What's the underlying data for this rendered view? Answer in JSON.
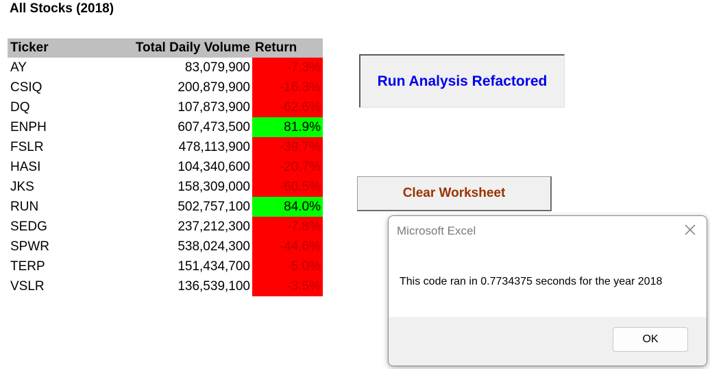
{
  "sheet": {
    "title": "All Stocks (2018)"
  },
  "table": {
    "headers": {
      "ticker": "Ticker",
      "volume": "Total Daily Volume",
      "return": "Return"
    },
    "rows": [
      {
        "ticker": "AY",
        "volume": "83,079,900",
        "return": "-7.3%",
        "status": "negative"
      },
      {
        "ticker": "CSIQ",
        "volume": "200,879,900",
        "return": "-16.3%",
        "status": "negative"
      },
      {
        "ticker": "DQ",
        "volume": "107,873,900",
        "return": "-62.6%",
        "status": "negative"
      },
      {
        "ticker": "ENPH",
        "volume": "607,473,500",
        "return": "81.9%",
        "status": "positive"
      },
      {
        "ticker": "FSLR",
        "volume": "478,113,900",
        "return": "-39.7%",
        "status": "negative"
      },
      {
        "ticker": "HASI",
        "volume": "104,340,600",
        "return": "-20.7%",
        "status": "negative"
      },
      {
        "ticker": "JKS",
        "volume": "158,309,000",
        "return": "-60.5%",
        "status": "negative"
      },
      {
        "ticker": "RUN",
        "volume": "502,757,100",
        "return": "84.0%",
        "status": "positive"
      },
      {
        "ticker": "SEDG",
        "volume": "237,212,300",
        "return": "-7.8%",
        "status": "negative"
      },
      {
        "ticker": "SPWR",
        "volume": "538,024,300",
        "return": "-44.6%",
        "status": "negative"
      },
      {
        "ticker": "TERP",
        "volume": "151,434,700",
        "return": "-5.0%",
        "status": "negative"
      },
      {
        "ticker": "VSLR",
        "volume": "136,539,100",
        "return": "-3.5%",
        "status": "negative"
      }
    ],
    "colors": {
      "positive_fill": "#00ff00",
      "negative_fill": "#ff0000",
      "header_fill": "#bfbfbf"
    }
  },
  "buttons": {
    "run_label": "Run Analysis Refactored",
    "clear_label": "Clear Worksheet"
  },
  "dialog": {
    "title": "Microsoft Excel",
    "message": "This code ran in 0.7734375 seconds for the year 2018",
    "ok_label": "OK",
    "close_icon": "close-icon"
  }
}
